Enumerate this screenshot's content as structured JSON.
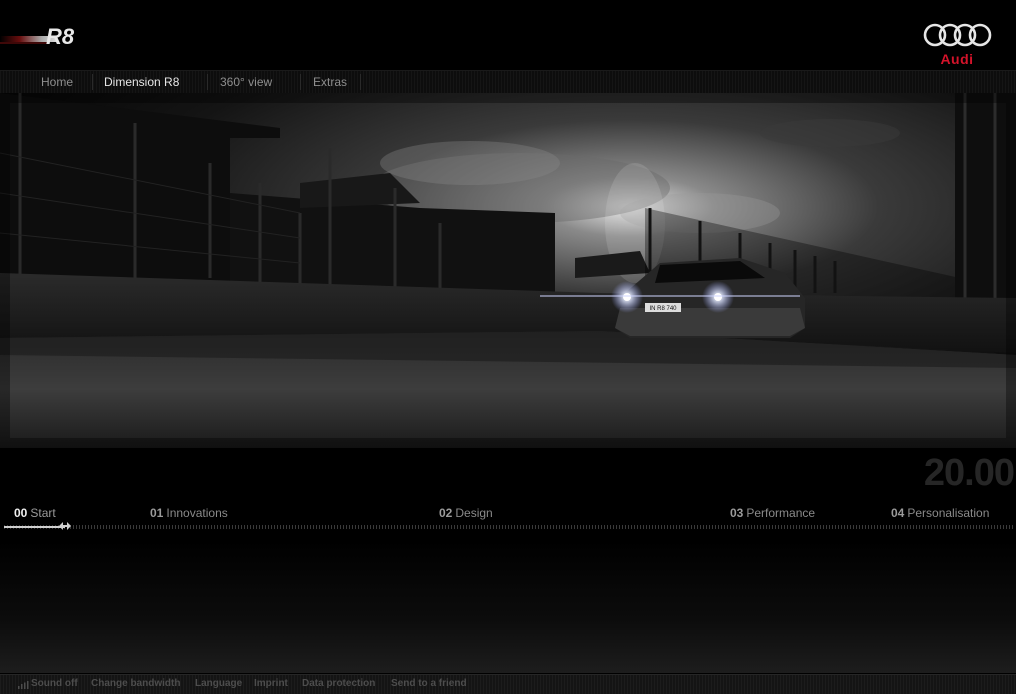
{
  "header": {
    "product_logo": "R8",
    "brand_logo": "Audi",
    "brand_color": "#d3132a"
  },
  "nav": {
    "items": [
      {
        "label": "Home"
      },
      {
        "label": "Dimension R8"
      },
      {
        "label": "360° view"
      },
      {
        "label": "Extras"
      }
    ],
    "active": "Dimension R8"
  },
  "hero": {
    "plate_text": "IN R8 740"
  },
  "timeline": {
    "timer": "20.00",
    "chapters": [
      {
        "num": "00",
        "label": "Start"
      },
      {
        "num": "01",
        "label": "Innovations"
      },
      {
        "num": "02",
        "label": "Design"
      },
      {
        "num": "03",
        "label": "Performance"
      },
      {
        "num": "04",
        "label": "Personalisation"
      }
    ],
    "active_chapter": "00",
    "progress_fraction": 0.06
  },
  "footer": {
    "items": [
      {
        "label": "Sound off",
        "icon": "sound-bars-icon"
      },
      {
        "label": "Change bandwidth"
      },
      {
        "label": "Language"
      },
      {
        "label": "Imprint"
      },
      {
        "label": "Data protection"
      },
      {
        "label": "Send to a friend"
      }
    ]
  }
}
